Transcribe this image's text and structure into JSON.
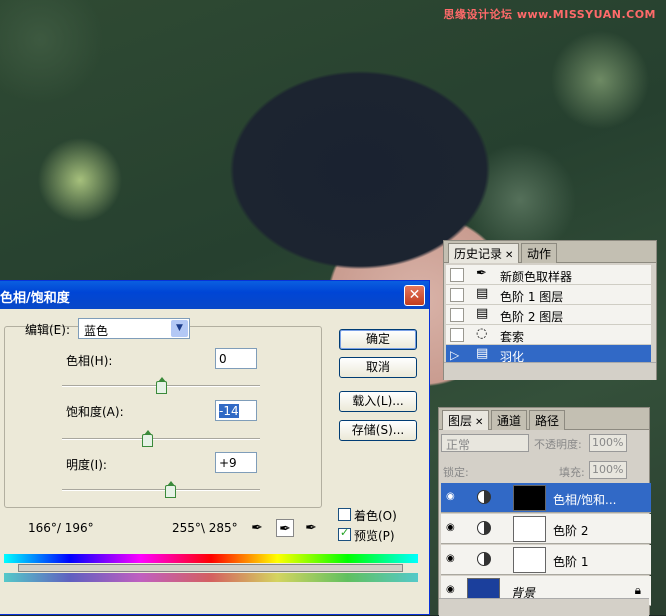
{
  "watermark": "思缘设计论坛 www.MISSYUAN.COM",
  "dialog": {
    "title": "色相/饱和度",
    "edit_label": "编辑(E):",
    "edit_value": "蓝色",
    "hue_label": "色相(H):",
    "hue_value": "0",
    "sat_label": "饱和度(A):",
    "sat_value": "-14",
    "light_label": "明度(I):",
    "light_value": "+9",
    "hue_level": 0.5,
    "sat_level": 0.43,
    "light_level": 0.545,
    "ok": "确定",
    "cancel": "取消",
    "load": "载入(L)...",
    "save": "存储(S)...",
    "colorize": "着色(O)",
    "preview": "预览(P)",
    "colorize_checked": false,
    "preview_checked": true,
    "range_left": "166°/ 196°",
    "range_right": "255°\\ 285°"
  },
  "history": {
    "tabs": [
      "历史记录",
      "动作"
    ],
    "items": [
      {
        "label": "新颜色取样器",
        "icon": "eyedropper-icon"
      },
      {
        "label": "色阶 1 图层",
        "icon": "document-icon"
      },
      {
        "label": "色阶 2 图层",
        "icon": "document-icon"
      },
      {
        "label": "套索",
        "icon": "lasso-icon"
      },
      {
        "label": "羽化",
        "icon": "document-icon",
        "active": true
      }
    ]
  },
  "layers": {
    "tabs": [
      "图层",
      "通道",
      "路径"
    ],
    "blend": "正常",
    "opacity_label": "不透明度:",
    "opacity": "100%",
    "lock_label": "锁定:",
    "fill_label": "填充:",
    "fill": "100%",
    "items": [
      {
        "label": "色相/饱和...",
        "active": true
      },
      {
        "label": "色阶 2"
      },
      {
        "label": "色阶 1"
      },
      {
        "label": "背景"
      }
    ]
  }
}
